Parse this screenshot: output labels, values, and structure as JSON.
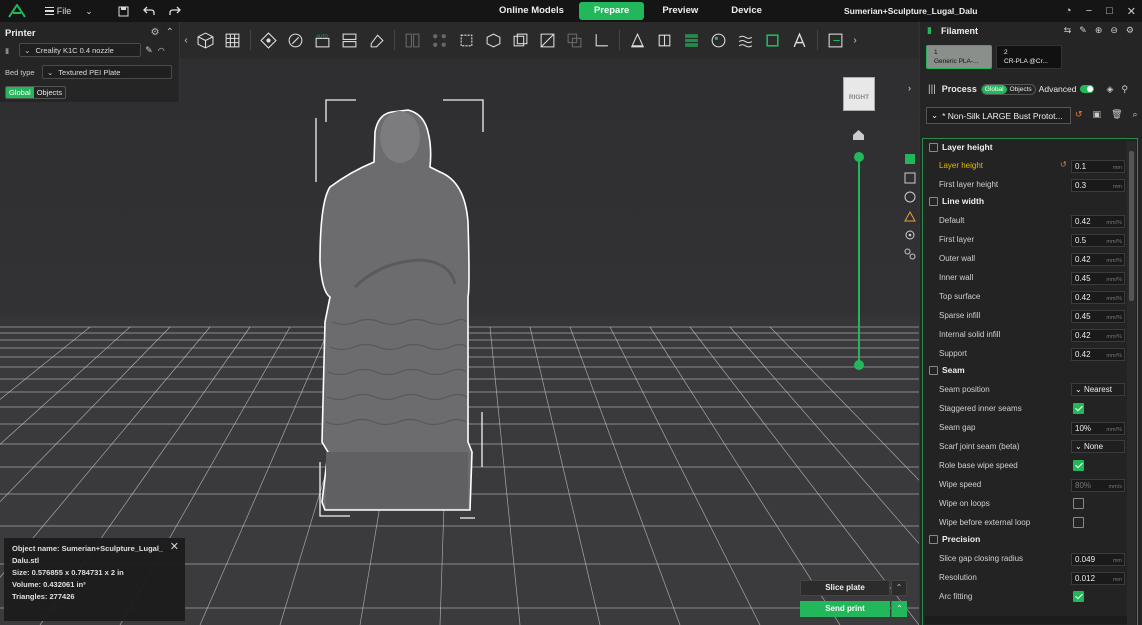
{
  "topbar": {
    "file_label": "File",
    "tabs": [
      {
        "label": "Online Models"
      },
      {
        "label": "Prepare"
      },
      {
        "label": "Preview"
      },
      {
        "label": "Device"
      }
    ],
    "project_title": "Sumerian+Sculpture_Lugal_Dalu",
    "win_min": "−",
    "win_max": "□",
    "win_close": "✕"
  },
  "printer": {
    "title": "Printer",
    "nozzle": "Creality K1C 0.4 nozzle",
    "bed_type_label": "Bed type",
    "bed_type_value": "Textured PEI Plate",
    "scope_global": "Global",
    "scope_objects": "Objects"
  },
  "filament": {
    "title": "Filament",
    "slots": [
      {
        "num": "1",
        "name": "Generic PLA-..."
      },
      {
        "num": "2",
        "name": "CR-PLA @Cr..."
      }
    ]
  },
  "process": {
    "title": "Process",
    "scope_global": "Global",
    "scope_objects": "Objects",
    "advanced_label": "Advanced",
    "preset": "* Non-Silk LARGE Bust Protot..."
  },
  "settings": {
    "layer_height_section": "Layer height",
    "layer_height_label": "Layer height",
    "layer_height_value": "0.1",
    "first_layer_height_label": "First layer height",
    "first_layer_height_value": "0.3",
    "line_width_section": "Line width",
    "lw_default_label": "Default",
    "lw_default_value": "0.42",
    "lw_first_layer_label": "First layer",
    "lw_first_layer_value": "0.5",
    "lw_outer_wall_label": "Outer wall",
    "lw_outer_wall_value": "0.42",
    "lw_inner_wall_label": "Inner wall",
    "lw_inner_wall_value": "0.45",
    "lw_top_surface_label": "Top surface",
    "lw_top_surface_value": "0.42",
    "lw_sparse_infill_label": "Sparse infill",
    "lw_sparse_infill_value": "0.45",
    "lw_internal_solid_label": "Internal solid infill",
    "lw_internal_solid_value": "0.42",
    "lw_support_label": "Support",
    "lw_support_value": "0.42",
    "unit_mm": "mm",
    "unit_mm_pct": "mm/%",
    "unit_mms": "mm/s",
    "seam_section": "Seam",
    "seam_position_label": "Seam position",
    "seam_position_value": "Nearest",
    "staggered_label": "Staggered inner seams",
    "staggered_checked": true,
    "seam_gap_label": "Seam gap",
    "seam_gap_value": "10%",
    "scarf_label": "Scarf joint seam (beta)",
    "scarf_value": "None",
    "role_wipe_label": "Role base wipe speed",
    "role_wipe_checked": true,
    "wipe_speed_label": "Wipe speed",
    "wipe_speed_value": "80%",
    "wipe_loops_label": "Wipe on loops",
    "wipe_loops_checked": false,
    "wipe_before_label": "Wipe before external loop",
    "wipe_before_checked": false,
    "precision_section": "Precision",
    "slice_gap_label": "Slice gap closing radius",
    "slice_gap_value": "0.049",
    "resolution_label": "Resolution",
    "resolution_value": "0.012",
    "arc_fitting_label": "Arc fitting",
    "arc_fitting_checked": true
  },
  "object_info": {
    "name_line": "Object name: Sumerian+Sculpture_Lugal_",
    "name_cont": "Dalu.stl",
    "size": "Size: 0.576855 x 0.784731 x 2 in",
    "volume": "Volume: 0.432061 in³",
    "triangles": "Triangles: 277426"
  },
  "actions": {
    "slice": "Slice plate",
    "send": "Send print"
  },
  "viewcube_label": "RIGHT",
  "colors": {
    "accent": "#21b75a",
    "bg": "#1e1e1f"
  }
}
